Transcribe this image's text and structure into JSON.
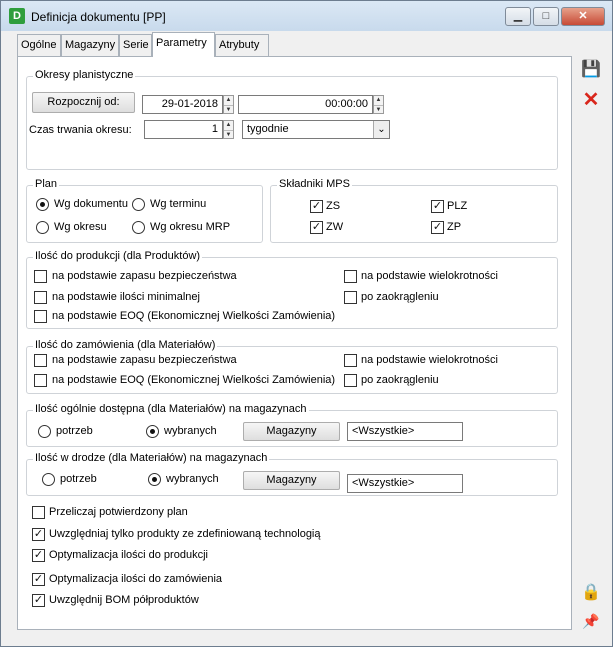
{
  "window": {
    "title": "Definicja dokumentu [PP]",
    "app_icon_letter": "D",
    "controls": {
      "minimize": "▁",
      "maximize": "□",
      "close": "✕"
    }
  },
  "tabs": [
    "Ogólne",
    "Magazyny",
    "Serie",
    "Parametry",
    "Atrybuty"
  ],
  "active_tab": "Parametry",
  "okresy": {
    "title": "Okresy planistyczne",
    "start_button": "Rozpocznij od:",
    "date": "29-01-2018",
    "time": "00:00:00",
    "duration_label": "Czas trwania okresu:",
    "duration_value": "1",
    "duration_unit": "tygodnie"
  },
  "plan": {
    "title": "Plan",
    "options": [
      "Wg dokumentu",
      "Wg terminu",
      "Wg okresu",
      "Wg okresu MRP"
    ],
    "selected": "Wg dokumentu"
  },
  "mps": {
    "title": "Składniki MPS",
    "items": [
      {
        "label": "ZS",
        "checked": true
      },
      {
        "label": "PLZ",
        "checked": true
      },
      {
        "label": "ZW",
        "checked": true
      },
      {
        "label": "ZP",
        "checked": true
      }
    ]
  },
  "produkcja": {
    "title": "Ilość do produkcji (dla Produktów)",
    "options": [
      {
        "label": "na podstawie zapasu bezpieczeństwa",
        "checked": false
      },
      {
        "label": "na podstawie ilości minimalnej",
        "checked": false
      },
      {
        "label": "na podstawie EOQ (Ekonomicznej Wielkości Zamówienia)",
        "checked": false
      },
      {
        "label": "na podstawie wielokrotności",
        "checked": false
      },
      {
        "label": "po zaokrągleniu",
        "checked": false
      }
    ]
  },
  "zamowienia": {
    "title": "Ilość do zamówienia (dla Materiałów)",
    "options": [
      {
        "label": "na podstawie zapasu bezpieczeństwa",
        "checked": false
      },
      {
        "label": "na podstawie EOQ (Ekonomicznej Wielkości Zamówienia)",
        "checked": false
      },
      {
        "label": "na podstawie wielokrotności",
        "checked": false
      },
      {
        "label": "po zaokrągleniu",
        "checked": false
      }
    ]
  },
  "dostepna": {
    "title": "Ilość ogólnie dostępna (dla Materiałów) na magazynach",
    "option_all": "potrzeb",
    "option_selected": "wybranych",
    "selected": "wybranych",
    "button": "Magazyny",
    "value": "<Wszystkie>"
  },
  "w_drodze": {
    "title": "Ilość w drodze (dla Materiałów) na magazynach",
    "option_all": "potrzeb",
    "option_selected": "wybranych",
    "selected": "wybranych",
    "button": "Magazyny",
    "value": "<Wszystkie>"
  },
  "checks": [
    {
      "label": "Przeliczaj potwierdzony plan",
      "checked": false
    },
    {
      "label": "Uwzględniaj tylko produkty ze zdefiniowaną technologią",
      "checked": true
    },
    {
      "label": "Optymalizacja ilości do produkcji",
      "checked": true
    },
    {
      "label": "Optymalizacja ilości do zamówienia",
      "checked": true
    },
    {
      "label": "Uwzględnij BOM półproduktów",
      "checked": true
    }
  ],
  "check_mark": "✓",
  "side_icons": {
    "save": "💾",
    "cancel": "✕",
    "lock": "🔒",
    "pin": "📌"
  }
}
